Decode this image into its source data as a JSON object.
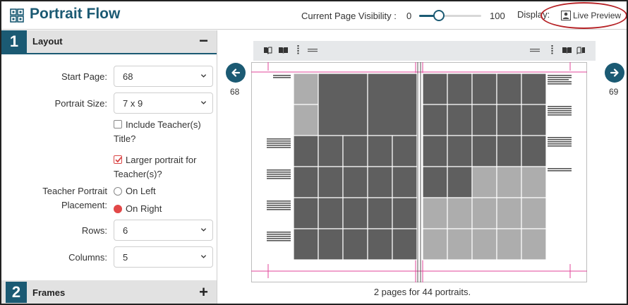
{
  "app": {
    "title": "Portrait Flow"
  },
  "header": {
    "visibility_label": "Current Page Visibility :",
    "visibility_min": "0",
    "visibility_max": "100",
    "visibility_value": 32,
    "display_label": "Display:",
    "live_preview_label": "Live Preview",
    "accent_color": "#1b5a73",
    "highlight_color": "#b62226"
  },
  "layout_section": {
    "number": "1",
    "title": "Layout",
    "toggle": "−",
    "fields": {
      "start_page_label": "Start Page:",
      "start_page_value": "68",
      "portrait_size_label": "Portrait Size:",
      "portrait_size_value": "7 x 9",
      "include_teacher_title_label": "Include Teacher(s) Title?",
      "include_teacher_title_checked": false,
      "larger_portrait_label": "Larger portrait for Teacher(s)?",
      "larger_portrait_checked": true,
      "teacher_placement_label_1": "Teacher Portrait",
      "teacher_placement_label_2": "Placement:",
      "placement_options": [
        "On Left",
        "On Right"
      ],
      "placement_selected": "On Right",
      "rows_label": "Rows:",
      "rows_value": "6",
      "columns_label": "Columns:",
      "columns_value": "5"
    }
  },
  "frames_section": {
    "number": "2",
    "title": "Frames",
    "toggle": "+"
  },
  "preview": {
    "left_page": "68",
    "right_page": "69",
    "summary": "2 pages for 44 portraits.",
    "toolbar_icons": [
      "book-left-icon",
      "book-open-icon",
      "vertical-text-icon",
      "name-abbrev-icon",
      "name-abbrev-icon",
      "vertical-text-icon",
      "book-open-icon",
      "book-right-icon"
    ],
    "toolbar_abbrev": "ABC"
  }
}
